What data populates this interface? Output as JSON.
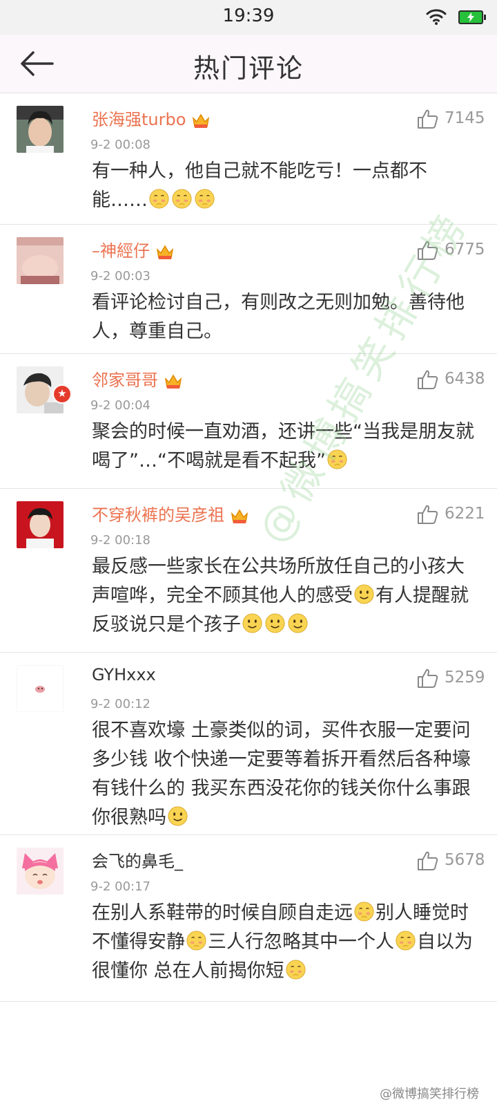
{
  "status_bar": {
    "time": "19:39"
  },
  "header": {
    "title": "热门评论"
  },
  "comments": [
    {
      "username": "张海强turbo",
      "likes": "7145",
      "time": "9-2 00:08",
      "text_1": "有一种人，他自己就不能吃亏！一点都不能……"
    },
    {
      "username": "–神經仔",
      "likes": "6775",
      "time": "9-2 00:03",
      "text_1": "看评论检讨自己，有则改之无则加勉。善待他人，尊重自己。"
    },
    {
      "username": "邻家哥哥",
      "likes": "6438",
      "time": "9-2 00:04",
      "text_1": "聚会的时候一直劝酒，还讲一些“当我是朋友就喝了”…“不喝就是看不起我”"
    },
    {
      "username": "不穿秋裤的吴彦祖",
      "likes": "6221",
      "time": "9-2 00:18",
      "text_1": "最反感一些家长在公共场所放任自己的小孩大声喧哗，完全不顾其他人的感受",
      "text_2": "有人提醒就反驳说只是个孩子"
    },
    {
      "username": "GYHxxx",
      "likes": "5259",
      "time": "9-2 00:12",
      "text_1": "很不喜欢壕 土豪类似的词，买件衣服一定要问多少钱 收个快递一定要等着拆开看然后各种壕 有钱什么的 我买东西没花你的钱关你什么事跟你很熟吗"
    },
    {
      "username": "会飞的鼻毛_",
      "likes": "5678",
      "time": "9-2 00:17",
      "text_1": "在别人系鞋带的时候自顾自走远",
      "text_2": "别人睡觉时不懂得安静",
      "text_3": "三人行忽略其中一个人",
      "text_4": "自以为很懂你 总在人前揭你短"
    }
  ],
  "watermark": {
    "diagonal": "@微博搞笑排行榜",
    "bottom": "@微博搞笑排行榜"
  },
  "colors": {
    "username": "#eb7350",
    "accent_green": "#26c03a"
  },
  "icons": [
    "wifi-icon",
    "battery-icon",
    "back-arrow-icon",
    "crown-badge-icon",
    "like-thumb-icon",
    "emoji-shy-icon",
    "emoji-smile-icon",
    "verified-badge-icon"
  ]
}
